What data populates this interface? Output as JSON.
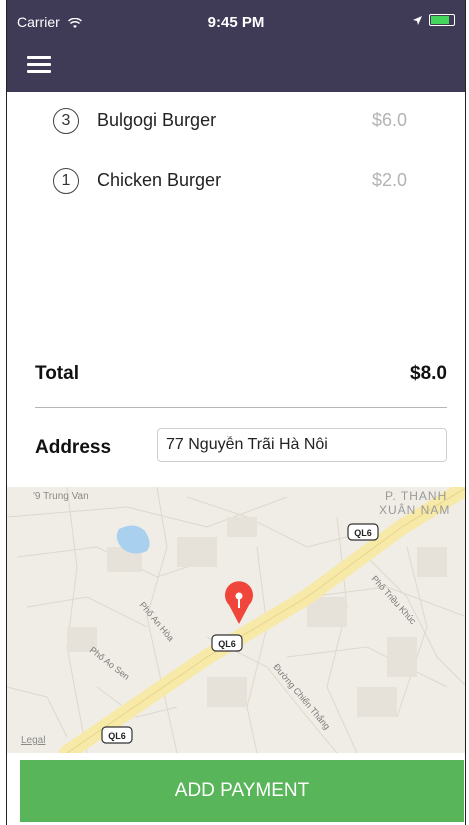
{
  "status_bar": {
    "carrier": "Carrier",
    "time": "9:45 PM",
    "wifi_icon": "wifi-icon",
    "location_icon": "location-arrow-icon",
    "battery_icon": "battery-icon"
  },
  "nav": {
    "menu_icon": "hamburger-menu-icon"
  },
  "order": {
    "items": [
      {
        "qty": "3",
        "name": "Bulgogi Burger",
        "price": "$6.0"
      },
      {
        "qty": "1",
        "name": "Chicken Burger",
        "price": "$2.0"
      }
    ],
    "total_label": "Total",
    "total_value": "$8.0"
  },
  "address": {
    "label": "Address",
    "value": "77 Nguyễn Trãi Hà Nôi"
  },
  "map": {
    "labels": {
      "trung_van": "'9 Trung Van",
      "p_thanh": "P. THANH",
      "xuan_nam": "XUÂN NAM",
      "pho_an_hoa": "Phố An Hòa",
      "pho_ao_sen": "Phố Ao Sen",
      "duong_chien_thang": "Đường Chiến Thắng",
      "pho_trieu_khuc": "Phố Triều Khúc",
      "legal": "Legal"
    },
    "road_shields": [
      "QL6",
      "QL6",
      "QL6"
    ],
    "pin_icon": "map-pin-icon",
    "colors": {
      "land": "#f0ede6",
      "highway": "#f7e9a8",
      "pin": "#f0453a",
      "water": "#a9d0ef"
    }
  },
  "actions": {
    "add_payment_label": "ADD PAYMENT"
  },
  "colors": {
    "header": "#3f3b57",
    "button": "#59b55a",
    "price_text": "#b3b3b3"
  }
}
